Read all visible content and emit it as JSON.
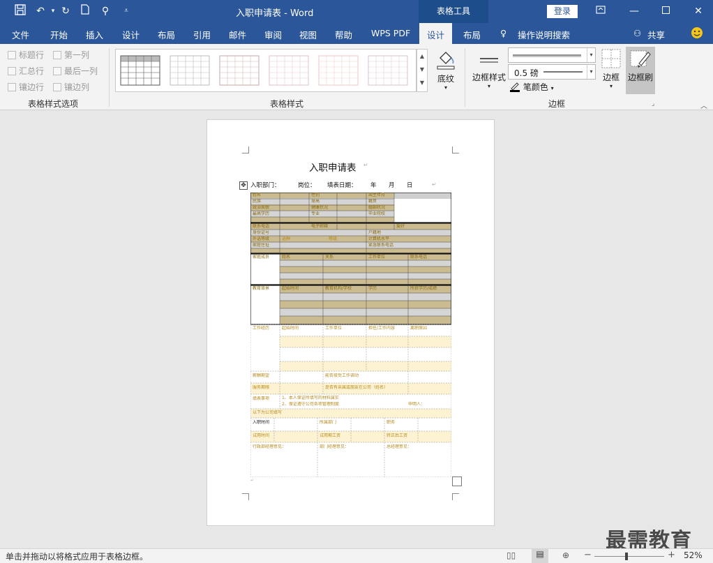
{
  "titlebar": {
    "doc_title": "入职申请表  -  Word",
    "context_tools": "表格工具",
    "login": "登录",
    "qa_icons": [
      "save-icon",
      "undo-icon",
      "dropdown-arrow-icon",
      "redo-icon",
      "new-doc-icon",
      "touch-mode-icon",
      "customize-icon"
    ]
  },
  "tabs": [
    "文件",
    "开始",
    "插入",
    "设计",
    "布局",
    "引用",
    "邮件",
    "审阅",
    "视图",
    "帮助",
    "WPS PDF",
    "设计",
    "布局"
  ],
  "search_label": "操作说明搜索",
  "share_label": "共享",
  "ribbon": {
    "style_options": {
      "items": [
        "标题行",
        "第一列",
        "汇总行",
        "最后一列",
        "镶边行",
        "镶边列"
      ],
      "group_label": "表格样式选项"
    },
    "styles": {
      "group_label": "表格样式",
      "shading": "底纹"
    },
    "borders": {
      "border_styles": "边框样式",
      "weight": "0.5 磅",
      "pen_color": "笔颜色",
      "borders_btn": "边框",
      "border_painter": "边框刷",
      "group_label": "边框"
    }
  },
  "document": {
    "title": "入职申请表",
    "header_dept": "入职部门：",
    "header_pos": "岗位：",
    "header_date": "填表日期：",
    "header_year": "年",
    "header_month": "月",
    "header_day": "日",
    "table_labels": {
      "name": "姓名",
      "gender": "性别",
      "birth": "出生年月",
      "ethnic": "民族",
      "height": "身高",
      "origin": "籍贯",
      "political": "政治面貌",
      "health": "健康状况",
      "marital": "婚姻状况",
      "education": "最高学历",
      "major": "专业",
      "school": "毕业院校",
      "phone": "联系电话",
      "email": "电子邮箱",
      "hobby": "爱好",
      "id_no": "身份证号",
      "hukou": "户籍地",
      "language": "外语等级",
      "lang_type": "语种",
      "level": "等级",
      "computer": "计算机水平",
      "address": "家庭住址",
      "emergency": "紧急联系电话",
      "family": "家庭成员",
      "fam_name": "姓名",
      "relation": "关系",
      "work_unit": "工作单位",
      "contact": "联系电话",
      "edu_bg": "教育背景",
      "time_range": "起始时间",
      "institution": "教育机构/学校",
      "degree": "学历",
      "major_deg": "所获学历/成绩",
      "work_exp": "工作经历",
      "start_time": "起始时间",
      "employer": "工作单位",
      "position_content": "担任/工作内容",
      "leave_reason": "离职原因",
      "benefits": "薪酬期望",
      "current_unit": "能否接受工作调动",
      "other": "服务期限",
      "relatives": "是否有亲属或朋友在公司（姓名）",
      "notes": "填表事项",
      "note1": "1、本人保证所填写的材料属实",
      "note2": "2、保证遵守公司各项管理制度",
      "signature": "申明人：",
      "company_fill": "以下为公司填写",
      "entry_time": "入职时间",
      "dept": "所属部门",
      "post": "职务",
      "probation": "试用时间",
      "probation_pay": "试用期工资",
      "regular_pay": "转正后工资",
      "admin_opinion": "行政部经理意见：",
      "dept_opinion": "部门经理意见：",
      "gm_opinion": "总经理意见："
    }
  },
  "status": {
    "message": "单击并拖动以将格式应用于表格边框。",
    "zoom": "52%"
  },
  "watermark": "最需教育"
}
